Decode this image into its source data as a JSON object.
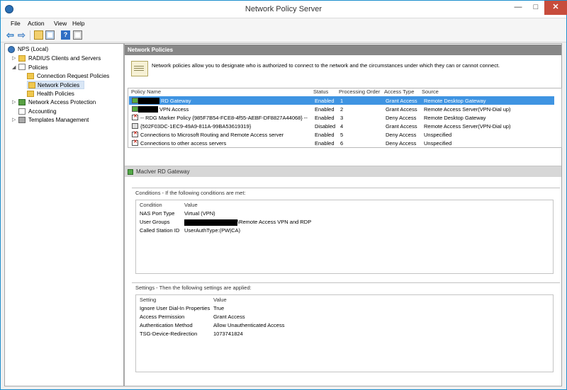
{
  "window": {
    "title": "Network Policy Server",
    "controls": {
      "minimize": "—",
      "maximize": "□",
      "close": "✕"
    }
  },
  "menu": [
    "File",
    "Action",
    "View",
    "Help"
  ],
  "tree": {
    "items": [
      {
        "label": "NPS (Local)"
      },
      {
        "label": "RADIUS Clients and Servers"
      },
      {
        "label": "Policies"
      },
      {
        "label": "Connection Request Policies"
      },
      {
        "label": "Network Policies"
      },
      {
        "label": "Health Policies"
      },
      {
        "label": "Network Access Protection"
      },
      {
        "label": "Accounting"
      },
      {
        "label": "Templates Management"
      }
    ]
  },
  "main": {
    "header": "Network Policies",
    "intro": "Network policies allow you to designate who is authorized to connect to the network and the circumstances under which they can or cannot connect.",
    "columns": [
      "Policy Name",
      "Status",
      "Processing Order",
      "Access Type",
      "Source"
    ],
    "rows": [
      {
        "name": "RD Gateway",
        "status": "Enabled",
        "order": "1",
        "access": "Grant Access",
        "source": "Remote Desktop Gateway"
      },
      {
        "name": "VPN Access",
        "status": "Enabled",
        "order": "2",
        "access": "Grant Access",
        "source": "Remote Access Server(VPN-Dial up)"
      },
      {
        "name": "-- RDG Marker Policy {985F7B54-FCE8-4f55-AEBF-DF8827A44068} --",
        "status": "Enabled",
        "order": "3",
        "access": "Deny Access",
        "source": "Remote Desktop Gateway"
      },
      {
        "name": "{502F03DC-1EC9-49A9-811A-99BA53619319}",
        "status": "Disabled",
        "order": "4",
        "access": "Grant Access",
        "source": "Remote Access Server(VPN-Dial up)"
      },
      {
        "name": "Connections to Microsoft Routing and Remote Access server",
        "status": "Enabled",
        "order": "5",
        "access": "Deny Access",
        "source": "Unspecified"
      },
      {
        "name": "Connections to other access servers",
        "status": "Enabled",
        "order": "6",
        "access": "Deny Access",
        "source": "Unspecified"
      }
    ]
  },
  "detail": {
    "title": "Maclver RD Gateway",
    "conditions": {
      "title": "Conditions - If the following conditions are met:",
      "cols": [
        "Condition",
        "Value"
      ],
      "rows": [
        {
          "k": "NAS Port Type",
          "v": "Virtual (VPN)"
        },
        {
          "k": "User Groups",
          "v": "\\Remote Access VPN and RDP"
        },
        {
          "k": "Called Station ID",
          "v": "UserAuthType:(PW|CA)"
        }
      ]
    },
    "settings": {
      "title": "Settings - Then the following settings are applied:",
      "cols": [
        "Setting",
        "Value"
      ],
      "rows": [
        {
          "k": "Ignore User Dial-In Properties",
          "v": "True"
        },
        {
          "k": "Access Permission",
          "v": "Grant Access"
        },
        {
          "k": "Authentication Method",
          "v": "Allow Unauthenticated Access"
        },
        {
          "k": "TSG-Device-Redirection",
          "v": "1073741824"
        }
      ]
    }
  }
}
